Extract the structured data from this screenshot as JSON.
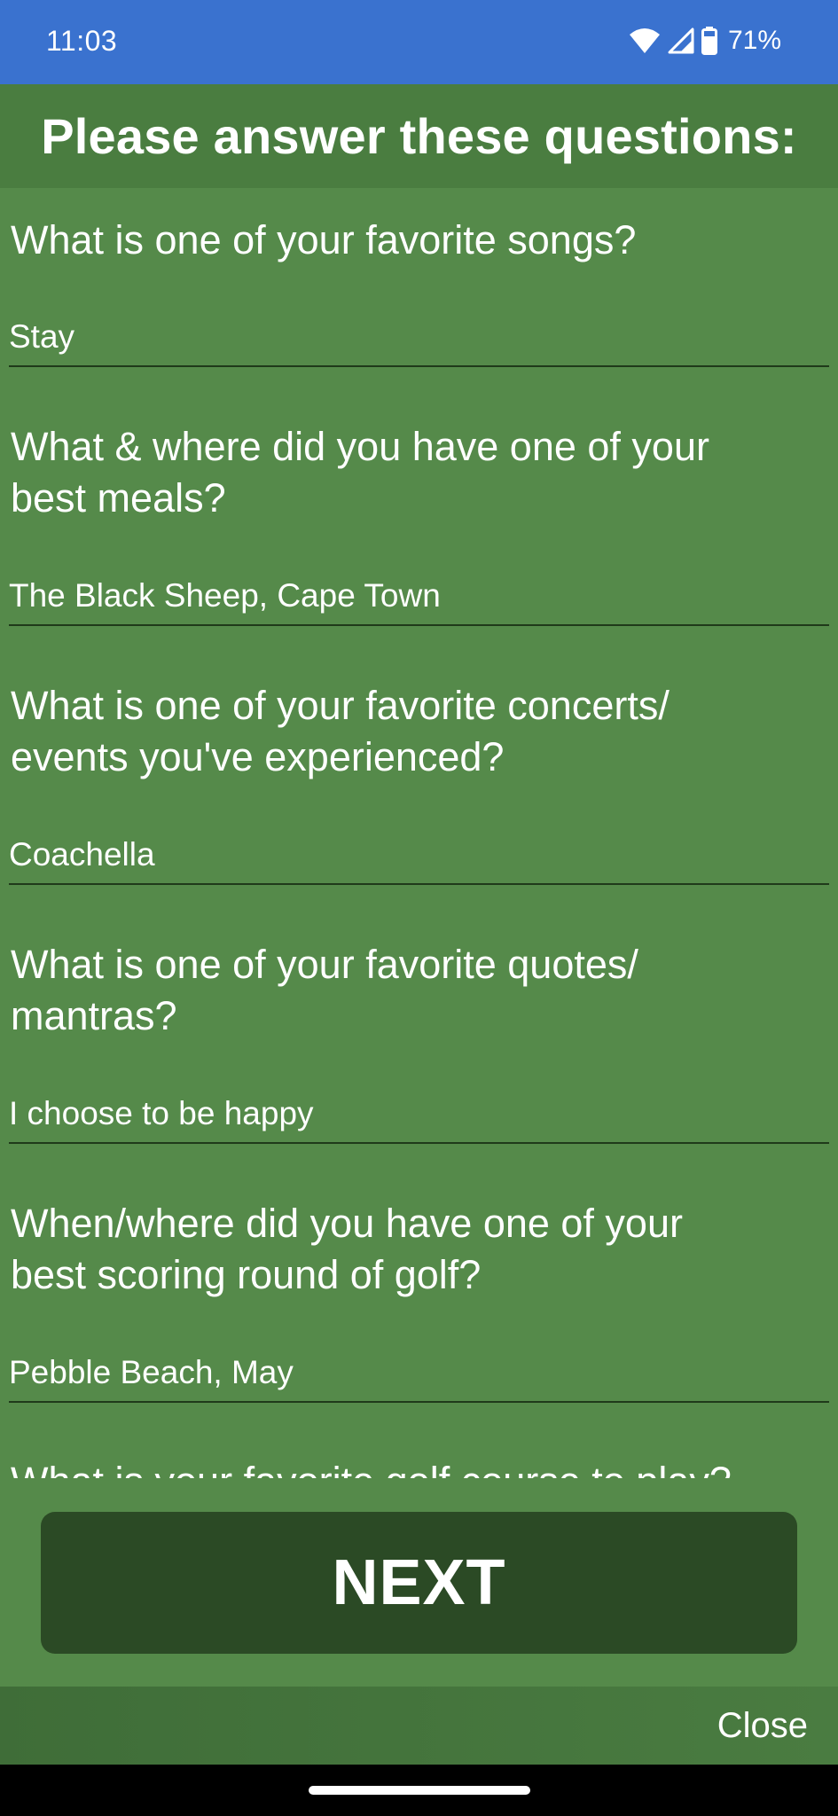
{
  "status_bar": {
    "time": "11:03",
    "battery_percent": "71%",
    "icons": [
      "wifi-icon",
      "signal-icon",
      "battery-icon"
    ]
  },
  "header": {
    "title": "Please answer these questions:"
  },
  "questions": [
    {
      "label_lines": [
        "What is one of your favorite songs?"
      ],
      "answer": "Stay"
    },
    {
      "label_lines": [
        "What & where did you have one of your",
        "best meals?"
      ],
      "answer": "The Black Sheep, Cape Town"
    },
    {
      "label_lines": [
        "What is one of your favorite concerts/",
        "events you've experienced?"
      ],
      "answer": "Coachella"
    },
    {
      "label_lines": [
        "What is one of your favorite quotes/",
        "mantras?"
      ],
      "answer": "I choose to be happy"
    },
    {
      "label_lines": [
        "When/where did you have one of your",
        "best scoring round of golf?"
      ],
      "answer": "Pebble Beach, May"
    },
    {
      "label_lines": [
        "What is your favorite golf course to play?"
      ],
      "answer": ""
    }
  ],
  "actions": {
    "next_label": "NEXT",
    "close_label": "Close"
  },
  "colors": {
    "status_bar": "#3a72cf",
    "background": "#558a4a",
    "header": "#4a7d40",
    "next_button": "#2b4a25",
    "underline": "#1f3a1a"
  }
}
